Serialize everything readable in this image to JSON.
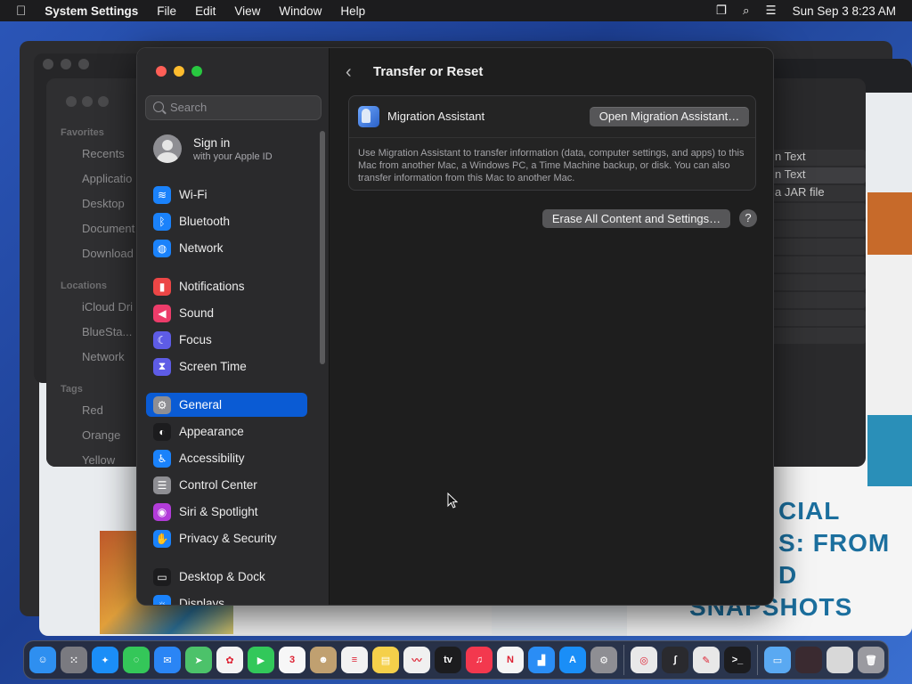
{
  "menubar": {
    "app_name": "System Settings",
    "menus": [
      "File",
      "Edit",
      "View",
      "Window",
      "Help"
    ],
    "clock": "Sun Sep 3  8:23 AM"
  },
  "background": {
    "finder_sections": {
      "favorites": "Favorites",
      "locations": "Locations",
      "tags": "Tags"
    },
    "finder_items": [
      "Recents",
      "Applicatio",
      "Desktop",
      "Document",
      "Download",
      "iCloud Dri",
      "BlueSta...",
      "Network",
      "Red",
      "Orange",
      "Yellow"
    ],
    "right_list": [
      "n Text",
      "n Text",
      "a JAR file"
    ],
    "poster_lines": [
      "CIAL",
      "S: FROM",
      "D",
      "SNAPSHOTS"
    ]
  },
  "sidebar": {
    "search_placeholder": "Search",
    "apple_id": {
      "title": "Sign in",
      "subtitle": "with your Apple ID"
    },
    "items": [
      {
        "label": "Wi-Fi",
        "icon": "wifi-icon",
        "color": "#1a82fb",
        "glyph": "≋"
      },
      {
        "label": "Bluetooth",
        "icon": "bluetooth-icon",
        "color": "#1a82fb",
        "glyph": "ᛒ"
      },
      {
        "label": "Network",
        "icon": "globe-icon",
        "color": "#1a82fb",
        "glyph": "◍"
      },
      {
        "label": "Notifications",
        "icon": "bell-icon",
        "color": "#ec4646",
        "glyph": "▮"
      },
      {
        "label": "Sound",
        "icon": "speaker-icon",
        "color": "#ec3c6a",
        "glyph": "◀"
      },
      {
        "label": "Focus",
        "icon": "moon-icon",
        "color": "#5e5ce6",
        "glyph": "☾"
      },
      {
        "label": "Screen Time",
        "icon": "hourglass-icon",
        "color": "#5e5ce6",
        "glyph": "⧗"
      },
      {
        "label": "General",
        "icon": "gear-icon",
        "color": "#8e8e93",
        "glyph": "⚙"
      },
      {
        "label": "Appearance",
        "icon": "appearance-icon",
        "color": "#1c1c1e",
        "glyph": "◐"
      },
      {
        "label": "Accessibility",
        "icon": "accessibility-icon",
        "color": "#1a82fb",
        "glyph": "♿"
      },
      {
        "label": "Control Center",
        "icon": "toggles-icon",
        "color": "#8e8e93",
        "glyph": "☰"
      },
      {
        "label": "Siri & Spotlight",
        "icon": "siri-icon",
        "color": "#b23cd9",
        "glyph": "◉"
      },
      {
        "label": "Privacy & Security",
        "icon": "hand-icon",
        "color": "#1a82fb",
        "glyph": "✋"
      },
      {
        "label": "Desktop & Dock",
        "icon": "dock-icon",
        "color": "#1c1c1e",
        "glyph": "▭"
      },
      {
        "label": "Displays",
        "icon": "display-icon",
        "color": "#1a82fb",
        "glyph": "☼"
      }
    ],
    "selected": "General"
  },
  "content": {
    "title": "Transfer or Reset",
    "migration": {
      "title": "Migration Assistant",
      "button": "Open Migration Assistant…",
      "description": "Use Migration Assistant to transfer information (data, computer settings, and apps) to this Mac from another Mac, a Windows PC, a Time Machine backup, or disk. You can also transfer information from this Mac to another Mac."
    },
    "erase_button": "Erase All Content and Settings…",
    "help_button": "?"
  },
  "dock": {
    "apps": [
      {
        "name": "finder-icon",
        "color": "#2e8ff0",
        "glyph": "☺"
      },
      {
        "name": "launchpad-icon",
        "color": "#7a7a80",
        "glyph": "⁙"
      },
      {
        "name": "safari-icon",
        "color": "#1b8ef7",
        "glyph": "✦"
      },
      {
        "name": "messages-icon",
        "color": "#34c759",
        "glyph": "◌"
      },
      {
        "name": "mail-icon",
        "color": "#2a85f5",
        "glyph": "✉"
      },
      {
        "name": "maps-icon",
        "color": "#4cc26a",
        "glyph": "➤"
      },
      {
        "name": "photos-icon",
        "color": "#f4f4f4",
        "glyph": "✿"
      },
      {
        "name": "facetime-icon",
        "color": "#32c85a",
        "glyph": "▶"
      },
      {
        "name": "calendar-icon",
        "color": "#f7f7f7",
        "glyph": "3"
      },
      {
        "name": "contacts-icon",
        "color": "#c0a070",
        "glyph": "☻"
      },
      {
        "name": "reminders-icon",
        "color": "#f2f2f2",
        "glyph": "≡"
      },
      {
        "name": "notes-icon",
        "color": "#f5d04a",
        "glyph": "▤"
      },
      {
        "name": "freeform-icon",
        "color": "#f0f0f0",
        "glyph": "〰"
      },
      {
        "name": "tv-icon",
        "color": "#1c1c1e",
        "glyph": "tv"
      },
      {
        "name": "music-icon",
        "color": "#f3384e",
        "glyph": "♫"
      },
      {
        "name": "news-icon",
        "color": "#f5f5f5",
        "glyph": "N"
      },
      {
        "name": "keynote-icon",
        "color": "#2a8df5",
        "glyph": "▟"
      },
      {
        "name": "app-store-icon",
        "color": "#1a8ef7",
        "glyph": "A"
      },
      {
        "name": "system-settings-icon",
        "color": "#8e8e93",
        "glyph": "⚙"
      }
    ],
    "recent": [
      {
        "name": "chrome-icon",
        "color": "#e9e9e9",
        "glyph": "◎"
      },
      {
        "name": "instruments-icon",
        "color": "#2a2a2e",
        "glyph": "∫"
      },
      {
        "name": "script-editor-icon",
        "color": "#e8e8e8",
        "glyph": "✎"
      },
      {
        "name": "terminal-icon",
        "color": "#1c1c1e",
        "glyph": ">_"
      }
    ],
    "others": [
      {
        "name": "downloads-folder-icon",
        "color": "#5aa9f2",
        "glyph": "▭"
      },
      {
        "name": "window-thumbnail-icon",
        "color": "#3a2a30",
        "glyph": ""
      },
      {
        "name": "window-thumbnail-icon-2",
        "color": "#d8d8d8",
        "glyph": ""
      },
      {
        "name": "trash-icon",
        "color": "#9a9aa0",
        "glyph": "🗑"
      }
    ]
  }
}
